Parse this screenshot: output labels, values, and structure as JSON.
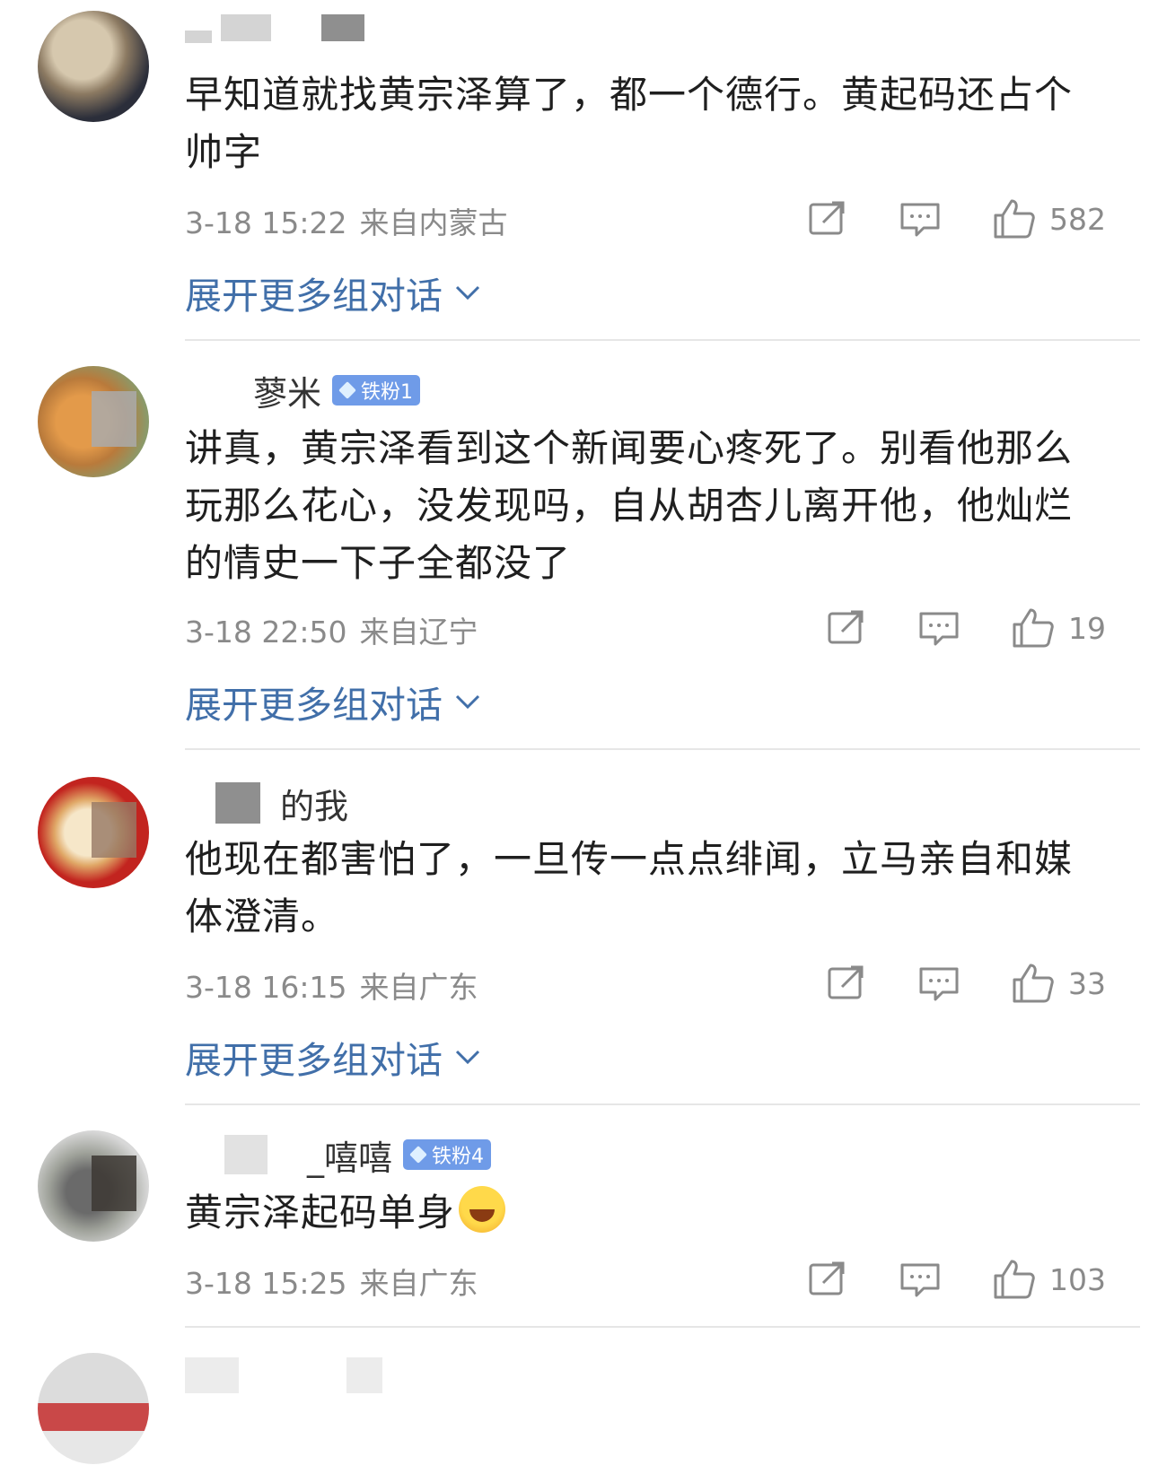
{
  "comments": [
    {
      "name_suffix": "",
      "badge": "",
      "text": "早知道就找黄宗泽算了，都一个德行。黄起码还占个帅字",
      "time": "3-18 15:22",
      "source": "来自内蒙古",
      "likes": "582",
      "expand": "展开更多组对话"
    },
    {
      "name_suffix": "蓼米",
      "badge": "铁粉1",
      "text": "讲真，黄宗泽看到这个新闻要心疼死了。别看他那么玩那么花心，没发现吗，自从胡杏儿离开他，他灿烂的情史一下子全都没了",
      "time": "3-18 22:50",
      "source": "来自辽宁",
      "likes": "19",
      "expand": "展开更多组对话"
    },
    {
      "name_suffix": "的我",
      "badge": "",
      "text": "他现在都害怕了，一旦传一点点绯闻，立马亲自和媒体澄清。",
      "time": "3-18 16:15",
      "source": "来自广东",
      "likes": "33",
      "expand": "展开更多组对话"
    },
    {
      "name_suffix": "_嘻嘻",
      "badge": "铁粉4",
      "text": "黄宗泽起码单身",
      "time": "3-18 15:25",
      "source": "来自广东",
      "likes": "103",
      "expand": ""
    }
  ],
  "icons": {
    "share": "share-icon",
    "comment": "comment-icon",
    "like": "thumbs-up-icon",
    "expand": "chevron-down-icon",
    "emoji": "laugh-cry-emoji"
  },
  "colors": {
    "link": "#416fa9",
    "meta": "#8a8a8a",
    "badge": "#6f9be8"
  }
}
